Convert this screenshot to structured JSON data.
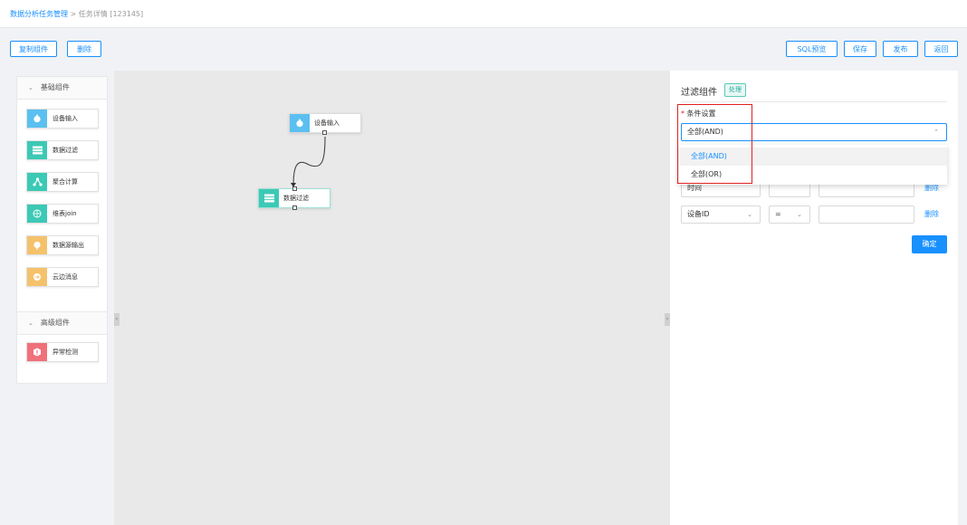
{
  "breadcrumb": {
    "parent": "数据分析任务管理",
    "separator": " > ",
    "current": "任务详情 [123145]"
  },
  "toolbar": {
    "copy_label": "复制组件",
    "delete_label": "删除",
    "sql_preview_label": "SQL预览",
    "save_label": "保存",
    "publish_label": "发布",
    "back_label": "返回"
  },
  "palette": {
    "basic_group": "基础组件",
    "basic_items": [
      {
        "label": "设备输入",
        "icon": "stopwatch-icon",
        "color": "#5bc0f0"
      },
      {
        "label": "数据过滤",
        "icon": "list-icon",
        "color": "#3cc9b5"
      },
      {
        "label": "聚合计算",
        "icon": "nodes-icon",
        "color": "#3cc9b5"
      },
      {
        "label": "维表join",
        "icon": "chart-circle-icon",
        "color": "#3cc9b5"
      },
      {
        "label": "数据源输出",
        "icon": "pin-icon",
        "color": "#f5c26b"
      },
      {
        "label": "云边消息",
        "icon": "message-icon",
        "color": "#f5c26b"
      }
    ],
    "advanced_group": "高级组件",
    "advanced_items": [
      {
        "label": "异常检测",
        "icon": "alert-box-icon",
        "color": "#f0707a"
      }
    ]
  },
  "canvas": {
    "nodes": [
      {
        "label": "设备输入",
        "icon": "stopwatch-icon",
        "color": "#5bc0f0"
      },
      {
        "label": "数据过滤",
        "icon": "list-icon",
        "color": "#3cc9b5"
      }
    ]
  },
  "panel": {
    "title": "过滤组件",
    "tag": "处理",
    "condition_label": "条件设置",
    "condition_value": "全部(AND)",
    "options": [
      "全部(AND)",
      "全部(OR)"
    ],
    "row1": {
      "field": "时间",
      "op": "",
      "value": "",
      "delete": "删除"
    },
    "row2": {
      "field": "设备ID",
      "op": "=",
      "value": "",
      "delete": "删除"
    },
    "confirm": "确定"
  },
  "colors": {
    "accent": "#1890ff",
    "highlight": "#e02020"
  }
}
